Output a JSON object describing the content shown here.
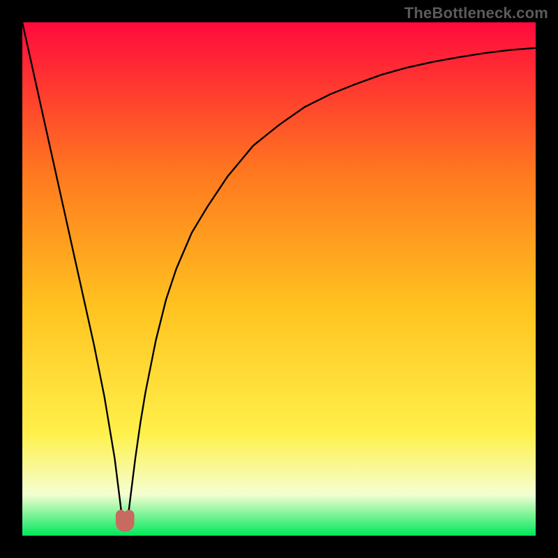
{
  "watermark": "TheBottleneck.com",
  "colors": {
    "black": "#000000",
    "gradient_top": "#ff0a3c",
    "gradient_mid_upper": "#ff7a1f",
    "gradient_mid": "#ffc21f",
    "gradient_mid_lower": "#fff04a",
    "gradient_pale": "#f4ffd2",
    "gradient_green": "#00e85a",
    "curve": "#000000",
    "marker": "#c96a60"
  },
  "chart_data": {
    "type": "line",
    "title": "",
    "xlabel": "",
    "ylabel": "",
    "xlim": [
      0,
      100
    ],
    "ylim": [
      0,
      100
    ],
    "series": [
      {
        "name": "bottleneck-curve",
        "x": [
          0,
          2,
          4,
          6,
          8,
          10,
          12,
          14,
          16,
          18,
          18.5,
          19,
          19.3,
          19.6,
          19.8,
          20,
          20.2,
          20.4,
          20.7,
          21,
          21.5,
          22,
          23,
          24,
          26,
          28,
          30,
          33,
          36,
          40,
          45,
          50,
          55,
          60,
          65,
          70,
          75,
          80,
          85,
          90,
          95,
          100
        ],
        "values": [
          100,
          91,
          82,
          73,
          64,
          55,
          46,
          37,
          27,
          15,
          11,
          7,
          4.5,
          2.8,
          2.0,
          1.8,
          2.0,
          2.8,
          4.5,
          7,
          11,
          15,
          22,
          28,
          38,
          46,
          52,
          59,
          64,
          70,
          76,
          80,
          83.5,
          86,
          88,
          89.8,
          91.2,
          92.3,
          93.2,
          94,
          94.6,
          95
        ],
        "color": "#000000"
      }
    ],
    "marker": {
      "name": "optimal-point",
      "x_range": [
        19.2,
        20.8
      ],
      "y": 1.8,
      "shape": "u",
      "color": "#c96a60"
    },
    "background": {
      "type": "vertical-gradient",
      "stops": [
        {
          "pos": 0.0,
          "color": "#ff0a3c"
        },
        {
          "pos": 0.3,
          "color": "#ff7a1f"
        },
        {
          "pos": 0.55,
          "color": "#ffc21f"
        },
        {
          "pos": 0.8,
          "color": "#fff04a"
        },
        {
          "pos": 0.92,
          "color": "#f4ffd2"
        },
        {
          "pos": 1.0,
          "color": "#00e85a"
        }
      ]
    }
  }
}
